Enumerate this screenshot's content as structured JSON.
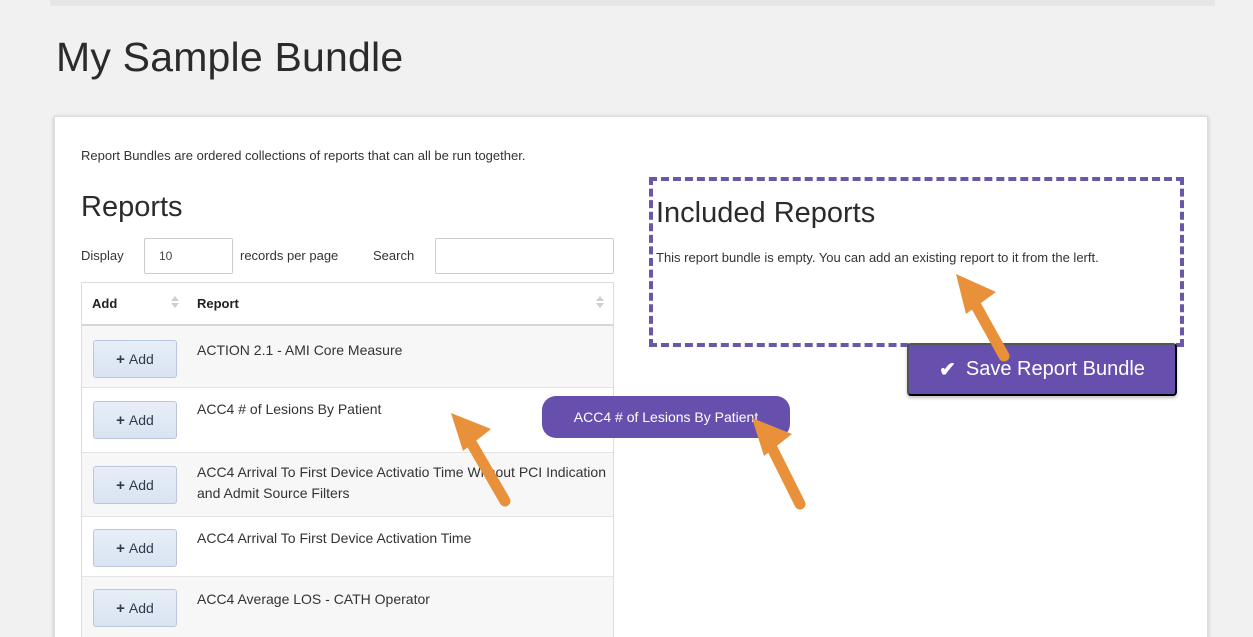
{
  "page": {
    "title": "My Sample Bundle"
  },
  "intro": "Report Bundles are ordered collections of reports that can all be run together.",
  "reports": {
    "heading": "Reports",
    "controls": {
      "display_label": "Display",
      "page_length": "10",
      "per_page_label": "records per page",
      "search_label": "Search",
      "search_value": ""
    },
    "columns": [
      "Add",
      "Report"
    ],
    "add_label": "Add",
    "rows": [
      "ACTION 2.1 - AMI Core Measure",
      "ACC4 # of Lesions By Patient",
      "ACC4 Arrival To First Device Activatio  Time Without PCI Indication and Admit Source Filters",
      "ACC4 Arrival To First Device Activation Time",
      "ACC4 Average LOS - CATH Operator"
    ]
  },
  "included": {
    "heading": "Included Reports",
    "empty_text": "This report bundle is empty. You can add an existing report to it from the lerft."
  },
  "save_button": {
    "label": "Save Report Bundle",
    "icon": "check-icon"
  },
  "drag_item": {
    "label": "ACC4 # of Lesions By Patient"
  },
  "colors": {
    "accent": "#6750ad",
    "annotation_arrow": "#e8913a"
  }
}
